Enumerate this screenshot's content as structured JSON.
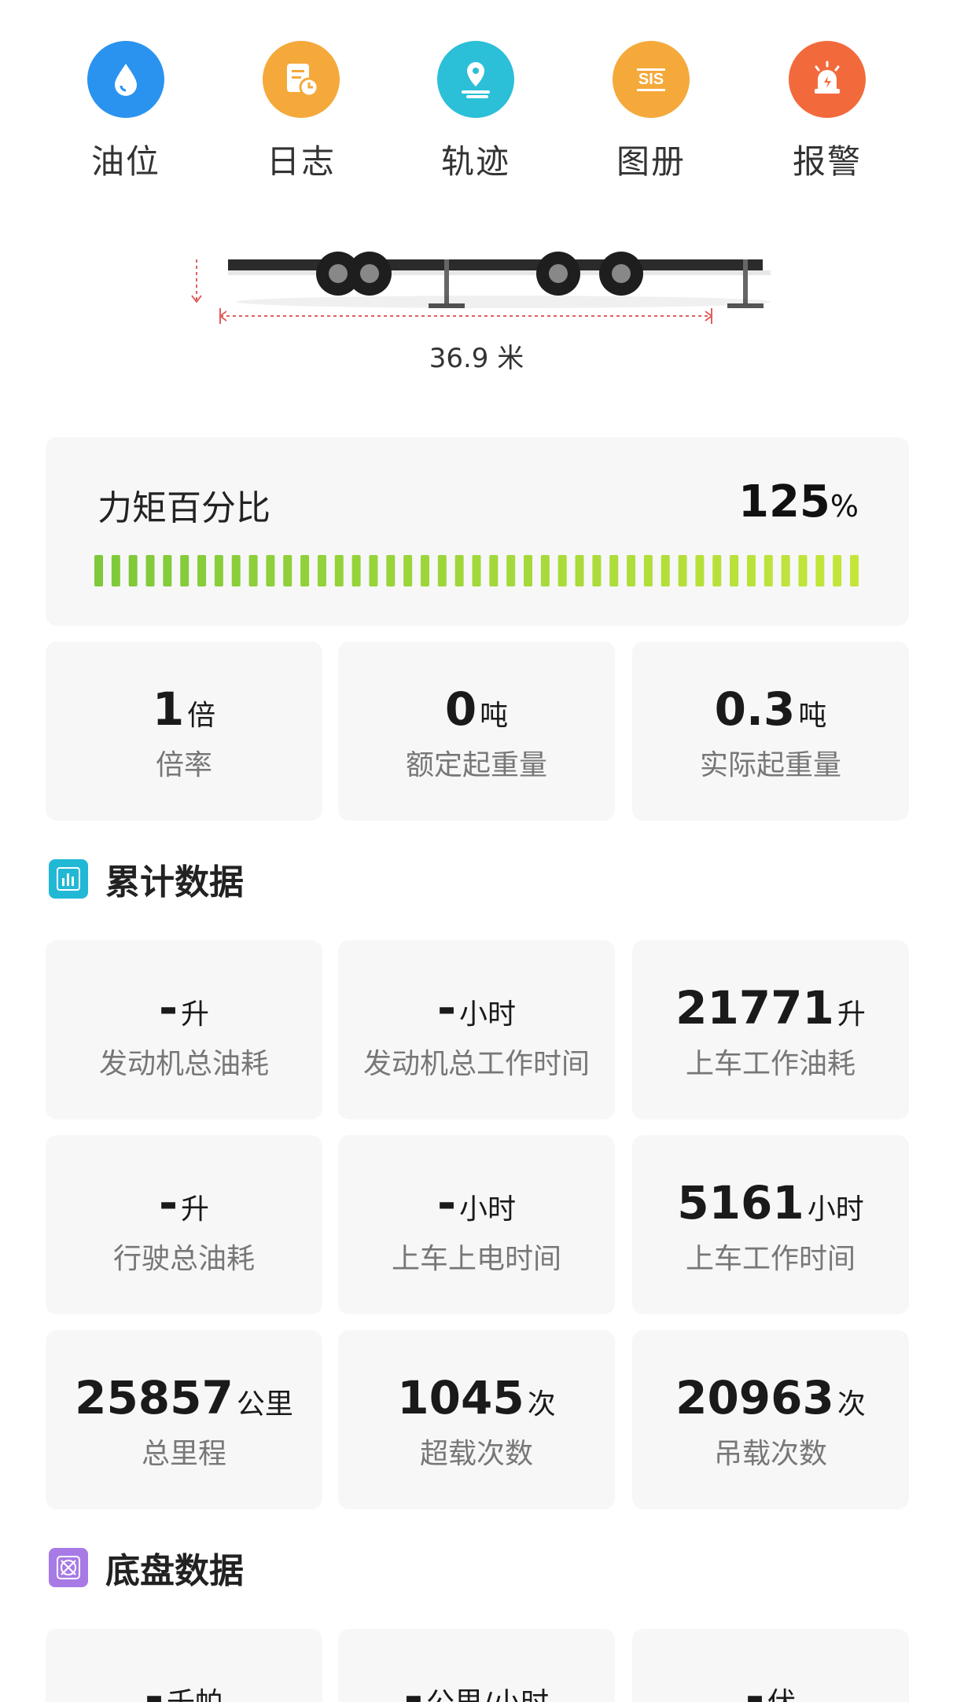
{
  "nav": [
    {
      "label": "油位",
      "icon": "oil-drop-icon",
      "color": "#2a93f0"
    },
    {
      "label": "日志",
      "icon": "log-document-icon",
      "color": "#f4a93a"
    },
    {
      "label": "轨迹",
      "icon": "location-track-icon",
      "color": "#2bbfd8"
    },
    {
      "label": "图册",
      "icon": "sis-manual-icon",
      "color": "#f4a93a"
    },
    {
      "label": "报警",
      "icon": "alarm-siren-icon",
      "color": "#f26a3c"
    }
  ],
  "crane": {
    "length_label": "36.9 米"
  },
  "torque": {
    "title": "力矩百分比",
    "value": "125",
    "unit": "%",
    "percent": 125,
    "bar_from": "#7dc93a",
    "bar_to": "#c4e63a"
  },
  "load_stats": [
    {
      "value": "1",
      "unit": "倍",
      "label": "倍率"
    },
    {
      "value": "0",
      "unit": "吨",
      "label": "额定起重量"
    },
    {
      "value": "0.3",
      "unit": "吨",
      "label": "实际起重量"
    }
  ],
  "cumulative": {
    "title": "累计数据",
    "icon": "bar-chart-icon",
    "items": [
      {
        "value": "-",
        "unit": "升",
        "label": "发动机总油耗"
      },
      {
        "value": "-",
        "unit": "小时",
        "label": "发动机总工作时间"
      },
      {
        "value": "21771",
        "unit": "升",
        "label": "上车工作油耗"
      },
      {
        "value": "-",
        "unit": "升",
        "label": "行驶总油耗"
      },
      {
        "value": "-",
        "unit": "小时",
        "label": "上车上电时间"
      },
      {
        "value": "5161",
        "unit": "小时",
        "label": "上车工作时间"
      },
      {
        "value": "25857",
        "unit": "公里",
        "label": "总里程"
      },
      {
        "value": "1045",
        "unit": "次",
        "label": "超载次数"
      },
      {
        "value": "20963",
        "unit": "次",
        "label": "吊载次数"
      }
    ]
  },
  "chassis": {
    "title": "底盘数据",
    "icon": "chassis-icon",
    "items": [
      {
        "value": "-",
        "unit": "千帕"
      },
      {
        "value": "-",
        "unit": "公里/小时"
      },
      {
        "value": "-",
        "unit": "伏"
      }
    ]
  }
}
